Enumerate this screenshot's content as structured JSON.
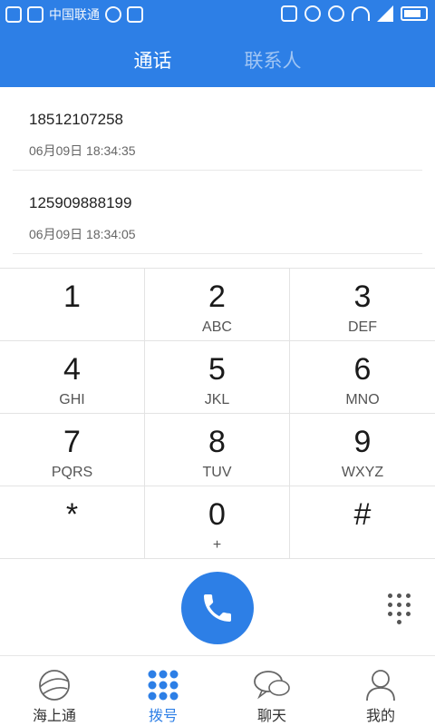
{
  "status_bar": {
    "carrier": "中国联通",
    "left_icons": [
      "notification-icon",
      "facebook-icon",
      "settings-icon",
      "messenger-icon",
      "app-icon"
    ],
    "right_icons": [
      "nfc-icon",
      "alarm-icon",
      "key-icon",
      "wifi-icon",
      "signal-icon",
      "battery-icon"
    ]
  },
  "tabs": [
    {
      "label": "通话",
      "active": true
    },
    {
      "label": "联系人",
      "active": false
    }
  ],
  "recent_calls": [
    {
      "number": "18512107258",
      "time": "06月09日 18:34:35"
    },
    {
      "number": "125909888199",
      "time": "06月09日 18:34:05"
    }
  ],
  "keypad": [
    {
      "digit": "1",
      "letters": ""
    },
    {
      "digit": "2",
      "letters": "ABC"
    },
    {
      "digit": "3",
      "letters": "DEF"
    },
    {
      "digit": "4",
      "letters": "GHI"
    },
    {
      "digit": "5",
      "letters": "JKL"
    },
    {
      "digit": "6",
      "letters": "MNO"
    },
    {
      "digit": "7",
      "letters": "PQRS"
    },
    {
      "digit": "8",
      "letters": "TUV"
    },
    {
      "digit": "9",
      "letters": "WXYZ"
    },
    {
      "digit": "*",
      "letters": ""
    },
    {
      "digit": "0",
      "letters": "+"
    },
    {
      "digit": "#",
      "letters": ""
    }
  ],
  "actions": {
    "call_icon": "phone-icon",
    "dialpad_icon": "dialpad-icon"
  },
  "bottom_nav": [
    {
      "label": "海上通",
      "icon": "globe-icon",
      "active": false
    },
    {
      "label": "拨号",
      "icon": "dialpad-icon",
      "active": true
    },
    {
      "label": "聊天",
      "icon": "chat-icon",
      "active": false
    },
    {
      "label": "我的",
      "icon": "person-icon",
      "active": false
    }
  ],
  "colors": {
    "accent": "#2d7fe6",
    "divider": "#e3e3e3"
  }
}
